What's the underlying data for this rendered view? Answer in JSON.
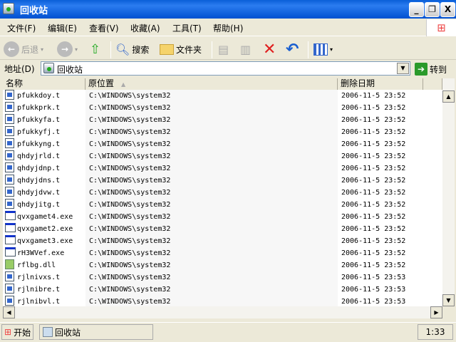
{
  "window": {
    "title": "回收站",
    "minimize": "_",
    "restore": "❐",
    "close": "X"
  },
  "menu": [
    "文件(F)",
    "编辑(E)",
    "查看(V)",
    "收藏(A)",
    "工具(T)",
    "帮助(H)"
  ],
  "toolbar": {
    "back": "后退",
    "search": "搜索",
    "folders": "文件夹"
  },
  "address": {
    "label": "地址(D)",
    "value": "回收站",
    "go": "转到"
  },
  "columns": [
    "名称",
    "原位置",
    "删除日期"
  ],
  "sort_column": "原位置",
  "files": [
    {
      "name": "pfukkdoy.t",
      "loc": "C:\\WINDOWS\\system32",
      "date": "2006-11-5 23:52",
      "type": "t"
    },
    {
      "name": "pfukkprk.t",
      "loc": "C:\\WINDOWS\\system32",
      "date": "2006-11-5 23:52",
      "type": "t"
    },
    {
      "name": "pfukkyfa.t",
      "loc": "C:\\WINDOWS\\system32",
      "date": "2006-11-5 23:52",
      "type": "t"
    },
    {
      "name": "pfukkyfj.t",
      "loc": "C:\\WINDOWS\\system32",
      "date": "2006-11-5 23:52",
      "type": "t"
    },
    {
      "name": "pfukkyng.t",
      "loc": "C:\\WINDOWS\\system32",
      "date": "2006-11-5 23:52",
      "type": "t"
    },
    {
      "name": "qhdyjrld.t",
      "loc": "C:\\WINDOWS\\system32",
      "date": "2006-11-5 23:52",
      "type": "t"
    },
    {
      "name": "qhdyjdnp.t",
      "loc": "C:\\WINDOWS\\system32",
      "date": "2006-11-5 23:52",
      "type": "t"
    },
    {
      "name": "qhdyjdns.t",
      "loc": "C:\\WINDOWS\\system32",
      "date": "2006-11-5 23:52",
      "type": "t"
    },
    {
      "name": "qhdyjdvw.t",
      "loc": "C:\\WINDOWS\\system32",
      "date": "2006-11-5 23:52",
      "type": "t"
    },
    {
      "name": "qhdyjitg.t",
      "loc": "C:\\WINDOWS\\system32",
      "date": "2006-11-5 23:52",
      "type": "t"
    },
    {
      "name": "qvxgamet4.exe",
      "loc": "C:\\WINDOWS\\system32",
      "date": "2006-11-5 23:52",
      "type": "exe"
    },
    {
      "name": "qvxgamet2.exe",
      "loc": "C:\\WINDOWS\\system32",
      "date": "2006-11-5 23:52",
      "type": "exe"
    },
    {
      "name": "qvxgamet3.exe",
      "loc": "C:\\WINDOWS\\system32",
      "date": "2006-11-5 23:52",
      "type": "exe"
    },
    {
      "name": "rH3WVef.exe",
      "loc": "C:\\WINDOWS\\system32",
      "date": "2006-11-5 23:52",
      "type": "exe"
    },
    {
      "name": "rflbg.dll",
      "loc": "C:\\WINDOWS\\system32",
      "date": "2006-11-5 23:52",
      "type": "dll"
    },
    {
      "name": "rjlnivxs.t",
      "loc": "C:\\WINDOWS\\system32",
      "date": "2006-11-5 23:53",
      "type": "t"
    },
    {
      "name": "rjlnibre.t",
      "loc": "C:\\WINDOWS\\system32",
      "date": "2006-11-5 23:53",
      "type": "t"
    },
    {
      "name": "rjlnibvl.t",
      "loc": "C:\\WINDOWS\\system32",
      "date": "2006-11-5 23:53",
      "type": "t"
    }
  ],
  "taskbar": {
    "start": "开始",
    "task": "回收站",
    "clock": "1:33"
  }
}
